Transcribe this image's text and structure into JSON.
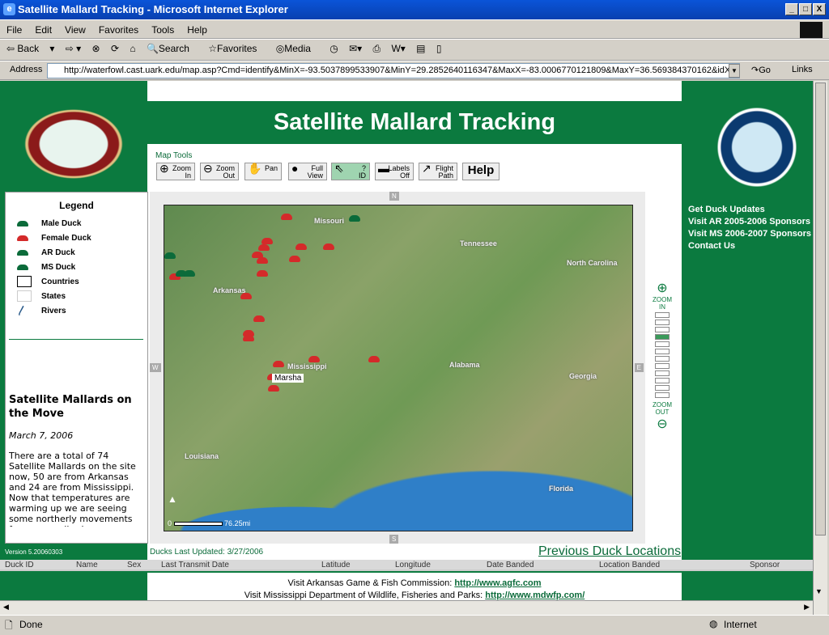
{
  "window": {
    "title": "Satellite Mallard Tracking - Microsoft Internet Explorer",
    "minimize": "_",
    "maximize": "□",
    "close": "X"
  },
  "menu": [
    "File",
    "Edit",
    "View",
    "Favorites",
    "Tools",
    "Help"
  ],
  "toolbar": {
    "back": "Back",
    "search": "Search",
    "favorites": "Favorites",
    "media": "Media"
  },
  "address": {
    "label": "Address",
    "url": "http://waterfowl.cast.uark.edu/map.asp?Cmd=identify&MinX=-93.5037899533907&MinY=29.2852640116347&MaxX=-83.0006770121809&MaxY=36.569384370162&idX=",
    "go": "Go",
    "links": "Links"
  },
  "page": {
    "title": "Satellite Mallard Tracking",
    "left_logo": "Arkansas Game & Fish Commission",
    "right_logo": "Mississippi Wildlife, Fisheries & Parks",
    "map_tools_label": "Map Tools",
    "tools": [
      {
        "l1": "Zoom",
        "l2": "In"
      },
      {
        "l1": "Zoom",
        "l2": "Out"
      },
      {
        "l1": "",
        "l2": "Pan"
      },
      {
        "l1": "Full",
        "l2": "View"
      },
      {
        "l1": "?",
        "l2": "ID"
      },
      {
        "l1": "Labels",
        "l2": "Off"
      },
      {
        "l1": "Flight",
        "l2": "Path"
      },
      {
        "l1": "",
        "l2": "Help"
      }
    ],
    "active_tool": "ID",
    "legend": {
      "title": "Legend",
      "items": [
        {
          "label": "Male Duck",
          "color": "#0b6b3a"
        },
        {
          "label": "Female Duck",
          "color": "#d42a2a"
        },
        {
          "label": "AR Duck",
          "color": "#0b6b3a"
        },
        {
          "label": "MS Duck",
          "color": "#0b6b3a"
        },
        {
          "label": "Countries",
          "color": "#000000"
        },
        {
          "label": "States",
          "color": "#cccccc"
        },
        {
          "label": "Rivers",
          "color": "#2a5a8a"
        }
      ]
    },
    "news": {
      "title": "Satellite Mallards on the Move",
      "date": "March 7, 2006",
      "body": "There are a total of 74 Satellite Mallards on the site now, 50 are from Arkansas and 24 are from Mississippi. Now that temperatures are warming up we are seeing some northerly movements from our mallards."
    },
    "version": "Version 5.20060303",
    "right_links": [
      "Get Duck Updates",
      "Visit AR 2005-2006 Sponsors",
      "Visit MS 2006-2007 Sponsors",
      "Contact Us"
    ],
    "map": {
      "states": [
        "Missouri",
        "Tennessee",
        "North Carolina",
        "Arkansas",
        "Mississippi",
        "Alabama",
        "Georgia",
        "Louisiana",
        "Florida"
      ],
      "label_marsha": "Marsha",
      "scale": "76.25mi",
      "scale_zero": "0",
      "compass": {
        "n": "N",
        "s": "S",
        "e": "E",
        "w": "W"
      },
      "zoom_in": "ZOOM IN",
      "zoom_out": "ZOOM OUT",
      "zoom_level": 4,
      "zoom_levels": 12
    },
    "updated": "Ducks Last Updated: 3/27/2006",
    "previous_link": "Previous Duck Locations",
    "table_headers": [
      "Duck ID",
      "Name",
      "Sex",
      "Last Transmit Date",
      "Latitude",
      "Longitude",
      "Date Banded",
      "Location Banded",
      "Sponsor"
    ],
    "footer": {
      "ar_text": "Visit Arkansas Game & Fish Commission:",
      "ar_link": "http://www.agfc.com",
      "ms_text": "Visit Mississippi Department of Wildlife, Fisheries and Parks:",
      "ms_link": "http://www.mdwfp.com/"
    }
  },
  "status": {
    "text": "Done",
    "zone": "Internet"
  },
  "colors": {
    "green": "#0b7a3f",
    "female": "#d42a2a",
    "male": "#0b6b3a"
  }
}
